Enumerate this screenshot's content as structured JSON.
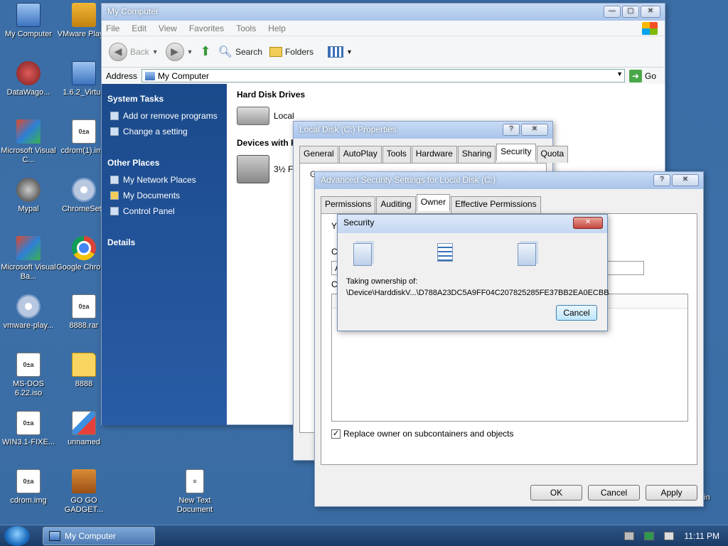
{
  "desktop": {
    "icons": [
      {
        "label": "My Computer",
        "icon": "computer-icon"
      },
      {
        "label": "VMware Player",
        "icon": "vmware-icon"
      },
      {
        "label": "DataWago...",
        "icon": "shortcut-icon"
      },
      {
        "label": "1.6.2_Virtua",
        "icon": "shortcut-icon"
      },
      {
        "label": "Microsoft Visual C...",
        "icon": "visual-c-icon"
      },
      {
        "label": "cdrom(1).img",
        "icon": "image-file-icon"
      },
      {
        "label": "Mypal",
        "icon": "mypal-icon"
      },
      {
        "label": "ChromeSetu",
        "icon": "setup-icon"
      },
      {
        "label": "Microsoft Visual Ba...",
        "icon": "visual-basic-icon"
      },
      {
        "label": "Google Chrome",
        "icon": "chrome-icon"
      },
      {
        "label": "vmware-play...",
        "icon": "installer-icon"
      },
      {
        "label": "8888.rar",
        "icon": "archive-icon"
      },
      {
        "label": "MS-DOS 6.22.iso",
        "icon": "iso-file-icon"
      },
      {
        "label": "8888",
        "icon": "folder-icon"
      },
      {
        "label": "WIN3.1-FIXE...",
        "icon": "image-file-icon"
      },
      {
        "label": "unnamed",
        "icon": "image-file-icon"
      },
      {
        "label": "cdrom.img",
        "icon": "image-file-icon"
      },
      {
        "label": "GO GO GADGET...",
        "icon": "briefcase-icon"
      },
      {
        "label": "New Text Document",
        "icon": "text-file-icon"
      }
    ],
    "partial_text_right": "in"
  },
  "mycomputer": {
    "title": "My Computer",
    "menu": [
      "File",
      "Edit",
      "View",
      "Favorites",
      "Tools",
      "Help"
    ],
    "toolbar": {
      "back": "Back",
      "search": "Search",
      "folders": "Folders"
    },
    "address": {
      "label": "Address",
      "value": "My Computer",
      "go": "Go"
    },
    "system_tasks": {
      "title": "System Tasks",
      "items": [
        "Add or remove programs",
        "Change a setting"
      ]
    },
    "other_places": {
      "title": "Other Places",
      "items": [
        "My Network Places",
        "My Documents",
        "Control Panel"
      ]
    },
    "details": {
      "title": "Details"
    },
    "hard_disk_drives": {
      "title": "Hard Disk Drives",
      "drive_label": "Local"
    },
    "removable": {
      "title": "Devices with Re",
      "drive_label": "3½ F"
    }
  },
  "properties": {
    "title": "Local Disk (C:) Properties",
    "tabs": [
      "General",
      "AutoPlay",
      "Tools",
      "Hardware",
      "Sharing",
      "Security",
      "Quota"
    ],
    "selected_tab": "Security",
    "partial_label": "Group or user names:"
  },
  "advanced": {
    "title": "Advanced Security Settings for Local Disk (C:)",
    "tabs": [
      "Permissions",
      "Auditing",
      "Owner",
      "Effective Permissions"
    ],
    "selected_tab": "Owner",
    "partial_labels": [
      "Y",
      "C",
      "A",
      "C",
      "F",
      "F",
      "c",
      "S"
    ],
    "checkbox_label": "Replace owner on subcontainers and objects",
    "checkbox_checked": true,
    "buttons": {
      "ok": "OK",
      "cancel": "Cancel",
      "apply": "Apply"
    }
  },
  "security_dialog": {
    "title": "Security",
    "line1": "Taking ownership of:",
    "line2": "\\Device\\HarddiskV...\\D788A23DC5A9FF04C207825285FE37BB2EA0ECBB",
    "cancel": "Cancel"
  },
  "taskbar": {
    "task_label": "My Computer",
    "time": "11:11 PM"
  }
}
